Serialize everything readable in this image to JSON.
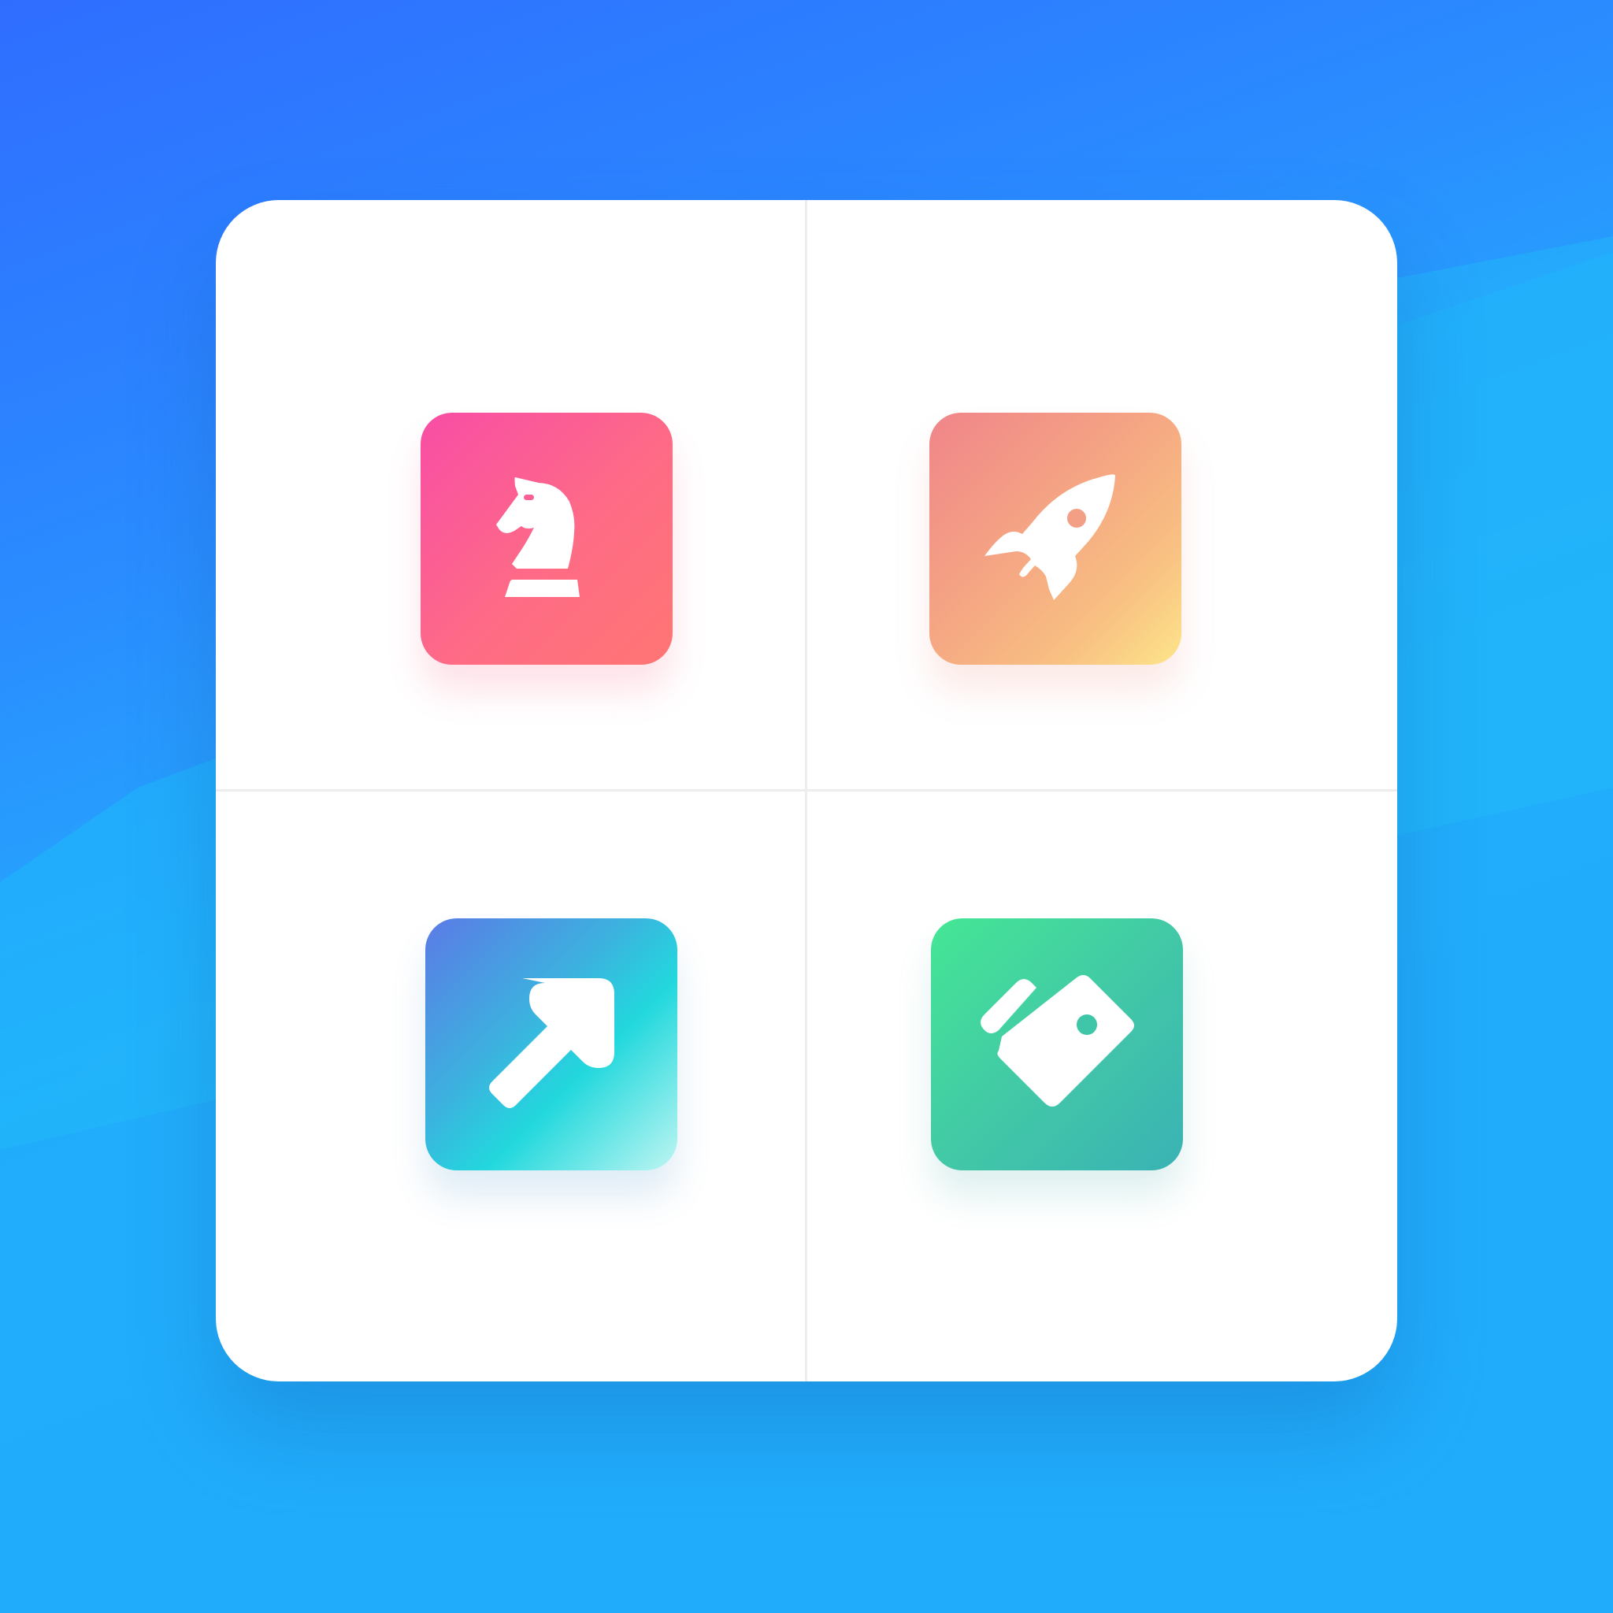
{
  "colors": {
    "background": "#2a8cff",
    "card": "#ffffff",
    "divider": "#ededed",
    "knight_tile": [
      "#f84da6",
      "#ff7673"
    ],
    "rocket_tile": [
      "#f0848a",
      "#fde58a"
    ],
    "arrow_tile": [
      "#5b7ae6",
      "#22d8dd",
      "#bff6f2"
    ],
    "tag_tile": [
      "#45e695",
      "#3ab2b4"
    ],
    "icon_glyph": "#ffffff"
  },
  "tiles": [
    {
      "icon": "chess-knight-icon"
    },
    {
      "icon": "rocket-icon"
    },
    {
      "icon": "arrow-up-right-icon"
    },
    {
      "icon": "price-tags-icon"
    }
  ]
}
